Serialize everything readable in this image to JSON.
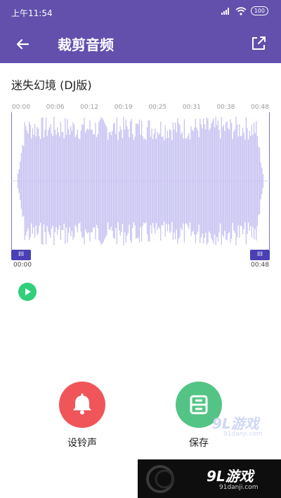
{
  "status_bar": {
    "time": "上午11:54",
    "battery": "100"
  },
  "app_bar": {
    "title": "裁剪音频",
    "back_icon": "back-arrow-icon",
    "share_icon": "share-icon"
  },
  "song": {
    "title": "迷失幻境 (DJ版)"
  },
  "timeline": {
    "ticks": [
      "00:00",
      "00:06",
      "00:12",
      "00:19",
      "00:25",
      "00:31",
      "00:38",
      "00:48"
    ]
  },
  "waveform": {
    "color": "#c7c2f2",
    "handle_color": "#4a3fb4"
  },
  "selection": {
    "start": "00:00",
    "end": "00:48",
    "handle_glyph": "III"
  },
  "actions": {
    "ringtone_label": "设铃声",
    "save_label": "保存"
  },
  "watermark": {
    "logo": "9L游戏",
    "site": "91danji.com"
  },
  "colors": {
    "accent": "#6250ac",
    "ringtone": "#f0555a",
    "save": "#53c485",
    "play": "#2fcf7c"
  }
}
